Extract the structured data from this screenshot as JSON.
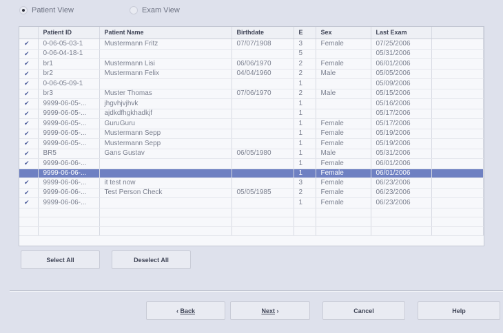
{
  "view_toggle": {
    "options": [
      {
        "label": "Patient View",
        "selected": true
      },
      {
        "label": "Exam View",
        "selected": false
      }
    ]
  },
  "grid": {
    "columns": [
      "",
      "Patient ID",
      "Patient Name",
      "Birthdate",
      "E",
      "Sex",
      "Last Exam",
      ""
    ],
    "rows": [
      {
        "checked": true,
        "id": "0-06-05-03-1",
        "name": "Mustermann Fritz",
        "birthdate": "07/07/1908",
        "e": "3",
        "sex": "Female",
        "last_exam": "07/25/2006",
        "selected": false
      },
      {
        "checked": true,
        "id": "0-06-04-18-1",
        "name": "",
        "birthdate": "",
        "e": "5",
        "sex": "",
        "last_exam": "05/31/2006",
        "selected": false
      },
      {
        "checked": true,
        "id": "br1",
        "name": "Mustermann Lisi",
        "birthdate": "06/06/1970",
        "e": "2",
        "sex": "Female",
        "last_exam": "06/01/2006",
        "selected": false
      },
      {
        "checked": true,
        "id": "br2",
        "name": "Mustermann Felix",
        "birthdate": "04/04/1960",
        "e": "2",
        "sex": "Male",
        "last_exam": "05/05/2006",
        "selected": false
      },
      {
        "checked": true,
        "id": "0-06-05-09-1",
        "name": "",
        "birthdate": "",
        "e": "1",
        "sex": "",
        "last_exam": "05/09/2006",
        "selected": false
      },
      {
        "checked": true,
        "id": "br3",
        "name": "Muster Thomas",
        "birthdate": "07/06/1970",
        "e": "2",
        "sex": "Male",
        "last_exam": "05/15/2006",
        "selected": false
      },
      {
        "checked": true,
        "id": "9999-06-05-...",
        "name": "jhgvhjvjhvk",
        "birthdate": "",
        "e": "1",
        "sex": "",
        "last_exam": "05/16/2006",
        "selected": false
      },
      {
        "checked": true,
        "id": "9999-06-05-...",
        "name": "ajdkdfhgkhadkjf",
        "birthdate": "",
        "e": "1",
        "sex": "",
        "last_exam": "05/17/2006",
        "selected": false
      },
      {
        "checked": true,
        "id": "9999-06-05-...",
        "name": "GuruGuru",
        "birthdate": "",
        "e": "1",
        "sex": "Female",
        "last_exam": "05/17/2006",
        "selected": false
      },
      {
        "checked": true,
        "id": "9999-06-05-...",
        "name": "Mustermann Sepp",
        "birthdate": "",
        "e": "1",
        "sex": "Female",
        "last_exam": "05/19/2006",
        "selected": false
      },
      {
        "checked": true,
        "id": "9999-06-05-...",
        "name": "Mustermann Sepp",
        "birthdate": "",
        "e": "1",
        "sex": "Female",
        "last_exam": "05/19/2006",
        "selected": false
      },
      {
        "checked": true,
        "id": "BR5",
        "name": "Gans Gustav",
        "birthdate": "06/05/1980",
        "e": "1",
        "sex": "Male",
        "last_exam": "05/31/2006",
        "selected": false
      },
      {
        "checked": true,
        "id": "9999-06-06-...",
        "name": "",
        "birthdate": "",
        "e": "1",
        "sex": "Female",
        "last_exam": "06/01/2006",
        "selected": false
      },
      {
        "checked": false,
        "id": "9999-06-06-...",
        "name": "",
        "birthdate": "",
        "e": "1",
        "sex": "Female",
        "last_exam": "06/01/2006",
        "selected": true
      },
      {
        "checked": true,
        "id": "9999-06-06-...",
        "name": "it test now",
        "birthdate": "",
        "e": "3",
        "sex": "Female",
        "last_exam": "06/23/2006",
        "selected": false
      },
      {
        "checked": true,
        "id": "9999-06-06-...",
        "name": "Test Person Check",
        "birthdate": "05/05/1985",
        "e": "2",
        "sex": "Female",
        "last_exam": "06/23/2006",
        "selected": false
      },
      {
        "checked": true,
        "id": "9999-06-06-...",
        "name": "",
        "birthdate": "",
        "e": "1",
        "sex": "Female",
        "last_exam": "06/23/2006",
        "selected": false
      }
    ]
  },
  "buttons": {
    "select_all": "Select All",
    "deselect_all": "Deselect All",
    "back": "Back",
    "next": "Next",
    "cancel": "Cancel",
    "help": "Help"
  },
  "icons": {
    "checkmark": "checkmark-icon"
  },
  "colors": {
    "selection": "#6e80c2",
    "background": "#dee1ec",
    "grid": "#f7f8fb"
  }
}
